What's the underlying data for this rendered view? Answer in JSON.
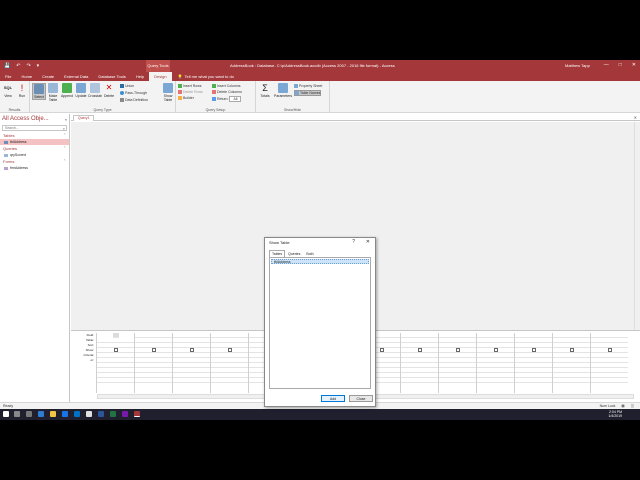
{
  "titlebar": {
    "context_tab": "Query Tools",
    "title": "AddressBook : Database- C:\\p\\AddressBook.accdb (Access 2007 - 2016 file format) - Access",
    "user": "Matthew Tapp",
    "min": "—",
    "max": "□",
    "close": "✕",
    "qat": [
      "💾",
      "↶",
      "↷",
      "▾"
    ]
  },
  "tabs": [
    "File",
    "Home",
    "Create",
    "External Data",
    "Database Tools",
    "Help",
    "Design"
  ],
  "tellme": "Tell me what you want to do",
  "ribbon": {
    "results": {
      "label": "Results",
      "view": "View",
      "run": "Run",
      "sql": "SQL"
    },
    "query_type": {
      "label": "Query Type",
      "select": "Select",
      "make_table": "Make Table",
      "append": "Append",
      "update": "Update",
      "crosstab": "Crosstab",
      "delete": "Delete",
      "union": "Union",
      "pass_through": "Pass-Through",
      "data_definition": "Data Definition"
    },
    "query_setup": {
      "label": "Query Setup",
      "show_table": "Show Table",
      "insert_rows": "Insert Rows",
      "delete_rows": "Delete Rows",
      "builder": "Builder",
      "insert_columns": "Insert Columns",
      "delete_columns": "Delete Columns",
      "return": "Return:",
      "return_value": "All"
    },
    "show_hide": {
      "label": "Show/Hide",
      "totals": "Totals",
      "parameters": "Parameters",
      "property_sheet": "Property Sheet",
      "table_names": "Table Names"
    }
  },
  "nav": {
    "title": "All Access Obje...",
    "search_placeholder": "Search...",
    "sections": [
      {
        "name": "Tables",
        "items": [
          "tblAddress"
        ]
      },
      {
        "name": "Queries",
        "items": [
          "qryScored"
        ]
      },
      {
        "name": "Forms",
        "items": [
          "frmAddress"
        ]
      }
    ]
  },
  "document": {
    "tab": "Query1",
    "close": "✕"
  },
  "qbe": {
    "row_labels": [
      "Field:",
      "Table:",
      "Sort:",
      "Show:",
      "Criteria:",
      "or:"
    ],
    "column_count": 14
  },
  "statusbar": {
    "left": "Ready",
    "num_lock": "Num Lock"
  },
  "taskbar": {
    "time": "2:04 PM",
    "date": "1/4/2019"
  },
  "dialog": {
    "title": "Show Table",
    "help": "?",
    "close": "✕",
    "tabs": [
      "Tables",
      "Queries",
      "Both"
    ],
    "items": [
      "tblAddress"
    ],
    "add": "Add",
    "close_btn": "Close"
  },
  "colors": {
    "accent": "#a4373a",
    "ribbon_bg": "#f3f3f3",
    "selection": "#cde3f7"
  }
}
